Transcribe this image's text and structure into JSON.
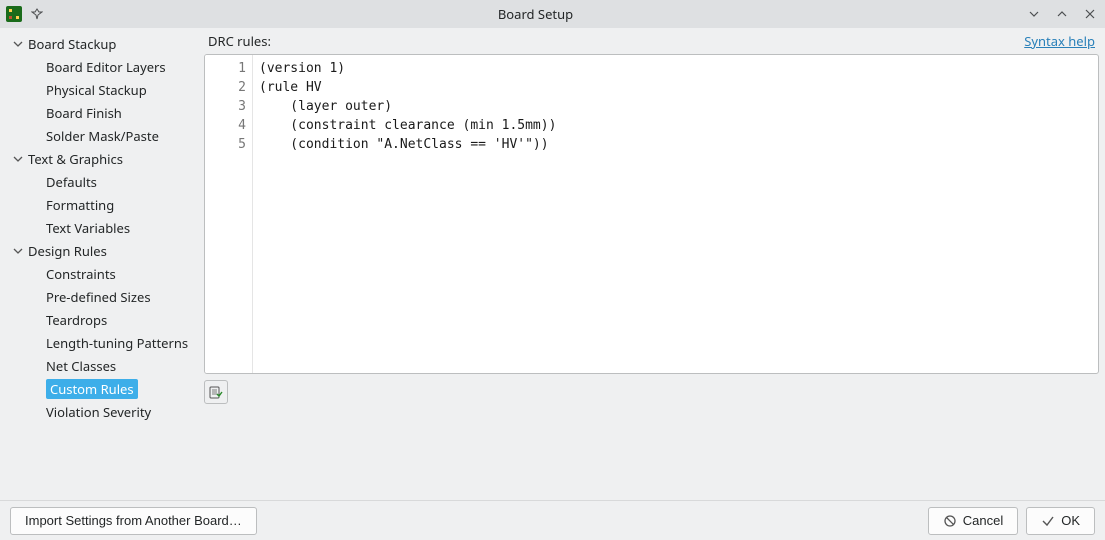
{
  "titlebar": {
    "title": "Board Setup"
  },
  "tree": {
    "sections": [
      {
        "label": "Board Stackup",
        "children": [
          {
            "label": "Board Editor Layers"
          },
          {
            "label": "Physical Stackup"
          },
          {
            "label": "Board Finish"
          },
          {
            "label": "Solder Mask/Paste"
          }
        ]
      },
      {
        "label": "Text & Graphics",
        "children": [
          {
            "label": "Defaults"
          },
          {
            "label": "Formatting"
          },
          {
            "label": "Text Variables"
          }
        ]
      },
      {
        "label": "Design Rules",
        "children": [
          {
            "label": "Constraints"
          },
          {
            "label": "Pre-defined Sizes"
          },
          {
            "label": "Teardrops"
          },
          {
            "label": "Length-tuning Patterns"
          },
          {
            "label": "Net Classes"
          },
          {
            "label": "Custom Rules",
            "selected": true
          },
          {
            "label": "Violation Severity"
          }
        ]
      }
    ]
  },
  "content": {
    "header_label": "DRC rules:",
    "syntax_help_label": "Syntax help",
    "code_lines": [
      "(version 1)",
      "(rule HV",
      "    (layer outer)",
      "    (constraint clearance (min 1.5mm))",
      "    (condition \"A.NetClass == 'HV'\"))"
    ]
  },
  "footer": {
    "import_label": "Import Settings from Another Board…",
    "cancel_label": "Cancel",
    "ok_label": "OK"
  }
}
